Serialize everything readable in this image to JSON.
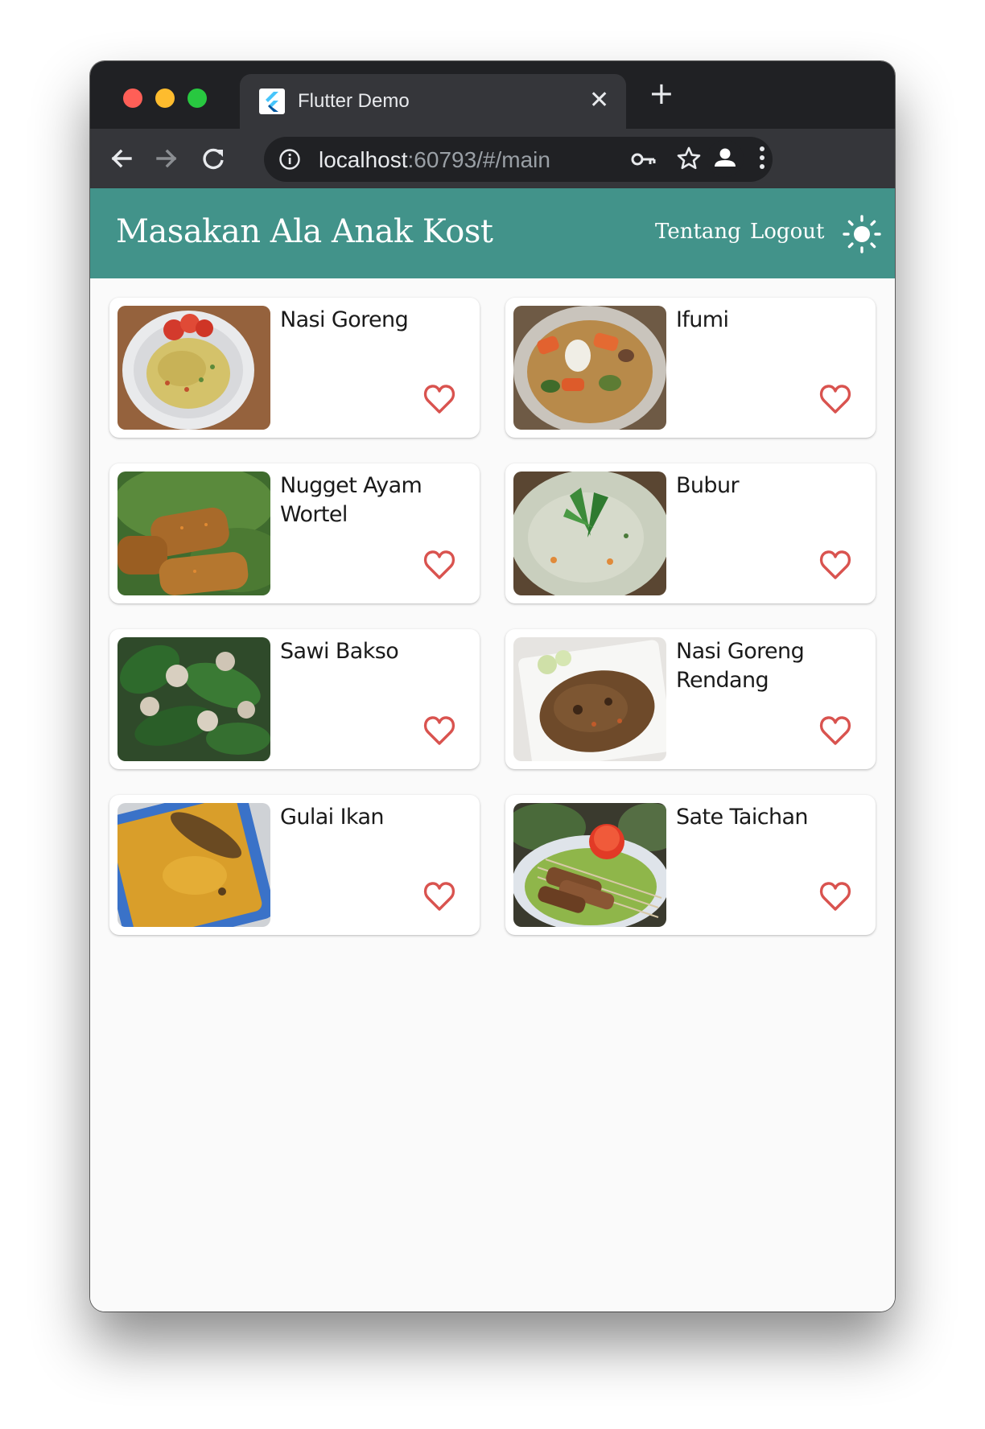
{
  "browser": {
    "tab_title": "Flutter Demo",
    "url_host": "localhost",
    "url_rest": ":60793/#/main"
  },
  "app": {
    "title": "Masakan Ala Anak Kost",
    "nav": {
      "about": "Tentang",
      "logout": "Logout"
    },
    "accent_color": "#42938a",
    "favorite_color": "#d9534f"
  },
  "recipes": [
    {
      "name": "Nasi Goreng"
    },
    {
      "name": "Ifumi"
    },
    {
      "name": "Nugget Ayam Wortel"
    },
    {
      "name": "Bubur"
    },
    {
      "name": "Sawi Bakso"
    },
    {
      "name": "Nasi Goreng Rendang"
    },
    {
      "name": "Gulai Ikan"
    },
    {
      "name": "Sate Taichan"
    }
  ]
}
